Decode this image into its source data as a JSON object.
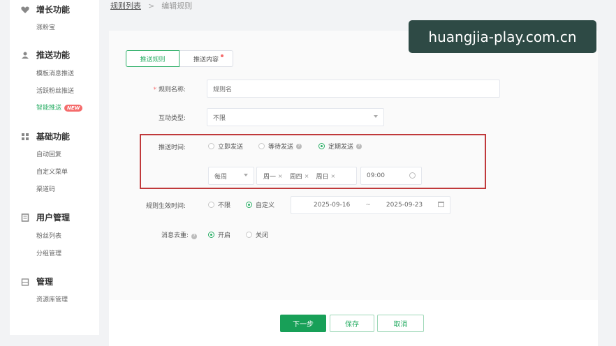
{
  "sidebar": {
    "groups": [
      {
        "title": "增长功能",
        "icon": "heart-icon",
        "items": [
          {
            "label": "涨粉宝"
          }
        ]
      },
      {
        "title": "推送功能",
        "icon": "users-icon",
        "items": [
          {
            "label": "模板消息推送"
          },
          {
            "label": "活跃粉丝推送"
          },
          {
            "label": "智能推送",
            "badge": "NEW"
          }
        ]
      },
      {
        "title": "基础功能",
        "icon": "grid-icon",
        "items": [
          {
            "label": "自动回复"
          },
          {
            "label": "自定义菜单"
          },
          {
            "label": "渠道码"
          }
        ]
      },
      {
        "title": "用户管理",
        "icon": "document-icon",
        "items": [
          {
            "label": "粉丝列表"
          },
          {
            "label": "分组管理"
          }
        ]
      },
      {
        "title": "管理",
        "icon": "cabinet-icon",
        "items": [
          {
            "label": "资源库管理"
          }
        ]
      }
    ]
  },
  "breadcrumb": {
    "parent": "规则列表",
    "separator": ">",
    "current": "编辑规则"
  },
  "watermark": "huangjia-play.com.cn",
  "tabs": [
    {
      "label": "推送规则"
    },
    {
      "label": "推送内容"
    }
  ],
  "form": {
    "rule_name": {
      "label": "规则名称:",
      "value": "规则名"
    },
    "interaction_type": {
      "label": "互动类型:",
      "value": "不限"
    },
    "push_time": {
      "label": "推送时间:",
      "options": [
        "立即发送",
        "等待发送",
        "定期发送"
      ],
      "selected": "定期发送",
      "frequency": "每周",
      "days": [
        "周一",
        "周四",
        "周日"
      ],
      "time": "09:00"
    },
    "effective_time": {
      "label": "规则生效时间:",
      "options": [
        "不限",
        "自定义"
      ],
      "selected": "自定义",
      "start": "2025-09-16",
      "range_sep": "~",
      "end": "2025-09-23"
    },
    "dedupe": {
      "label": "消息去重:",
      "options": [
        "开启",
        "关闭"
      ],
      "selected": "开启"
    }
  },
  "buttons": {
    "next": "下一步",
    "save": "保存",
    "cancel": "取消"
  },
  "colors": {
    "accent": "#2bae66",
    "highlight": "#c0393b",
    "badge": "#f56c6c"
  }
}
